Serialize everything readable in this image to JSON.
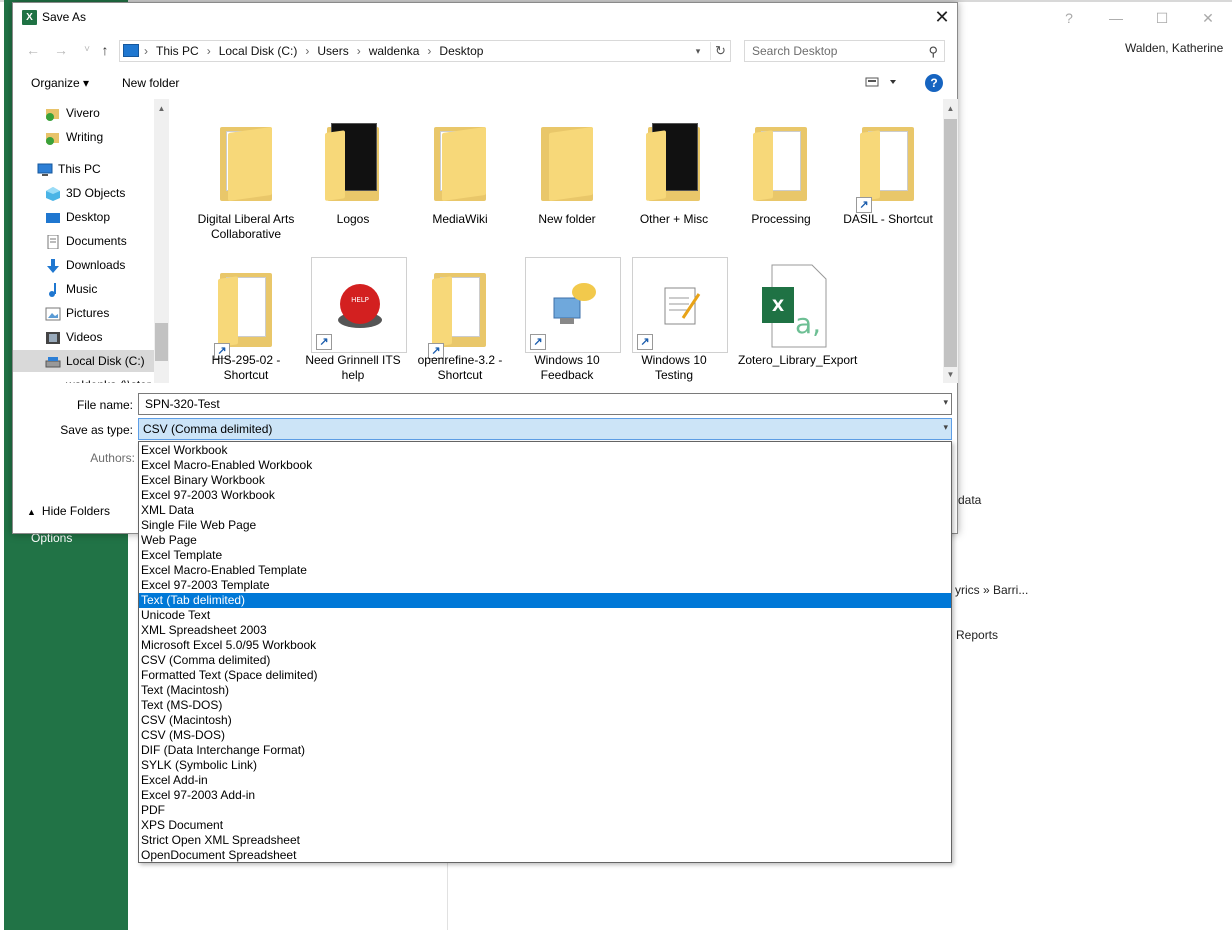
{
  "background": {
    "user_name": "Walden, Katherine",
    "options_label": "Options",
    "partial_texts": [
      "data",
      "yrics » Barri...",
      "Reports"
    ],
    "window_controls": [
      "?",
      "—",
      "☐",
      "✕"
    ],
    "accent_color": "#217346"
  },
  "dialog": {
    "title": "Save As",
    "app_icon_letter": "X",
    "close_label": "✕"
  },
  "nav": {
    "back_icon": "←",
    "forward_icon": "→",
    "recent_icon": "˅",
    "up_icon": "↑",
    "breadcrumb": [
      "This PC",
      "Local Disk (C:)",
      "Users",
      "waldenka",
      "Desktop"
    ],
    "refresh_icon": "↻",
    "search_placeholder": "Search Desktop"
  },
  "toolbar": {
    "organize_label": "Organize ▾",
    "new_folder_label": "New folder",
    "help_label": "?"
  },
  "sidebar": {
    "items": [
      {
        "label": "Vivero",
        "icon": "onedrive-folder-icon"
      },
      {
        "label": "Writing",
        "icon": "onedrive-folder-icon"
      },
      {
        "label": "This PC",
        "icon": "computer-icon"
      },
      {
        "label": "3D Objects",
        "icon": "cube-icon"
      },
      {
        "label": "Desktop",
        "icon": "desktop-icon"
      },
      {
        "label": "Documents",
        "icon": "documents-icon"
      },
      {
        "label": "Downloads",
        "icon": "download-icon"
      },
      {
        "label": "Music",
        "icon": "music-icon"
      },
      {
        "label": "Pictures",
        "icon": "pictures-icon"
      },
      {
        "label": "Videos",
        "icon": "videos-icon"
      },
      {
        "label": "Local Disk (C:)",
        "icon": "drive-icon"
      },
      {
        "label": "waldenka (\\\\stor",
        "icon": "network-drive-icon"
      }
    ]
  },
  "files": [
    {
      "name": "Digital Liberal Arts Collaborative",
      "kind": "folder"
    },
    {
      "name": "Logos",
      "kind": "folder-doc"
    },
    {
      "name": "MediaWiki",
      "kind": "folder"
    },
    {
      "name": "New folder",
      "kind": "folder"
    },
    {
      "name": "Other + Misc",
      "kind": "folder-doc"
    },
    {
      "name": "Processing",
      "kind": "folder"
    },
    {
      "name": "DASIL - Shortcut",
      "kind": "folder-shortcut"
    },
    {
      "name": "HIS-295-02 - Shortcut",
      "kind": "folder-shortcut"
    },
    {
      "name": "Need Grinnell ITS help",
      "kind": "image-shortcut",
      "badge": "HELP"
    },
    {
      "name": "openrefine-3.2 - Shortcut",
      "kind": "folder-shortcut"
    },
    {
      "name": "Windows 10 Feedback",
      "kind": "image-shortcut"
    },
    {
      "name": "Windows 10 Testing",
      "kind": "image-shortcut"
    },
    {
      "name": "Zotero_Library_Export",
      "kind": "excel-file",
      "badge": "X"
    }
  ],
  "form": {
    "file_name_label": "File name:",
    "file_name_value": "SPN-320-Test",
    "save_type_label": "Save as type:",
    "save_type_value": "CSV (Comma delimited)",
    "authors_label": "Authors:",
    "hide_folders_label": "Hide Folders"
  },
  "save_types": [
    "Excel Workbook",
    "Excel Macro-Enabled Workbook",
    "Excel Binary Workbook",
    "Excel 97-2003 Workbook",
    "XML Data",
    "Single File Web Page",
    "Web Page",
    "Excel Template",
    "Excel Macro-Enabled Template",
    "Excel 97-2003 Template",
    "Text (Tab delimited)",
    "Unicode Text",
    "XML Spreadsheet 2003",
    "Microsoft Excel 5.0/95 Workbook",
    "CSV (Comma delimited)",
    "Formatted Text (Space delimited)",
    "Text (Macintosh)",
    "Text (MS-DOS)",
    "CSV (Macintosh)",
    "CSV (MS-DOS)",
    "DIF (Data Interchange Format)",
    "SYLK (Symbolic Link)",
    "Excel Add-in",
    "Excel 97-2003 Add-in",
    "PDF",
    "XPS Document",
    "Strict Open XML Spreadsheet",
    "OpenDocument Spreadsheet"
  ],
  "selected_save_type": "Text (Tab delimited)"
}
